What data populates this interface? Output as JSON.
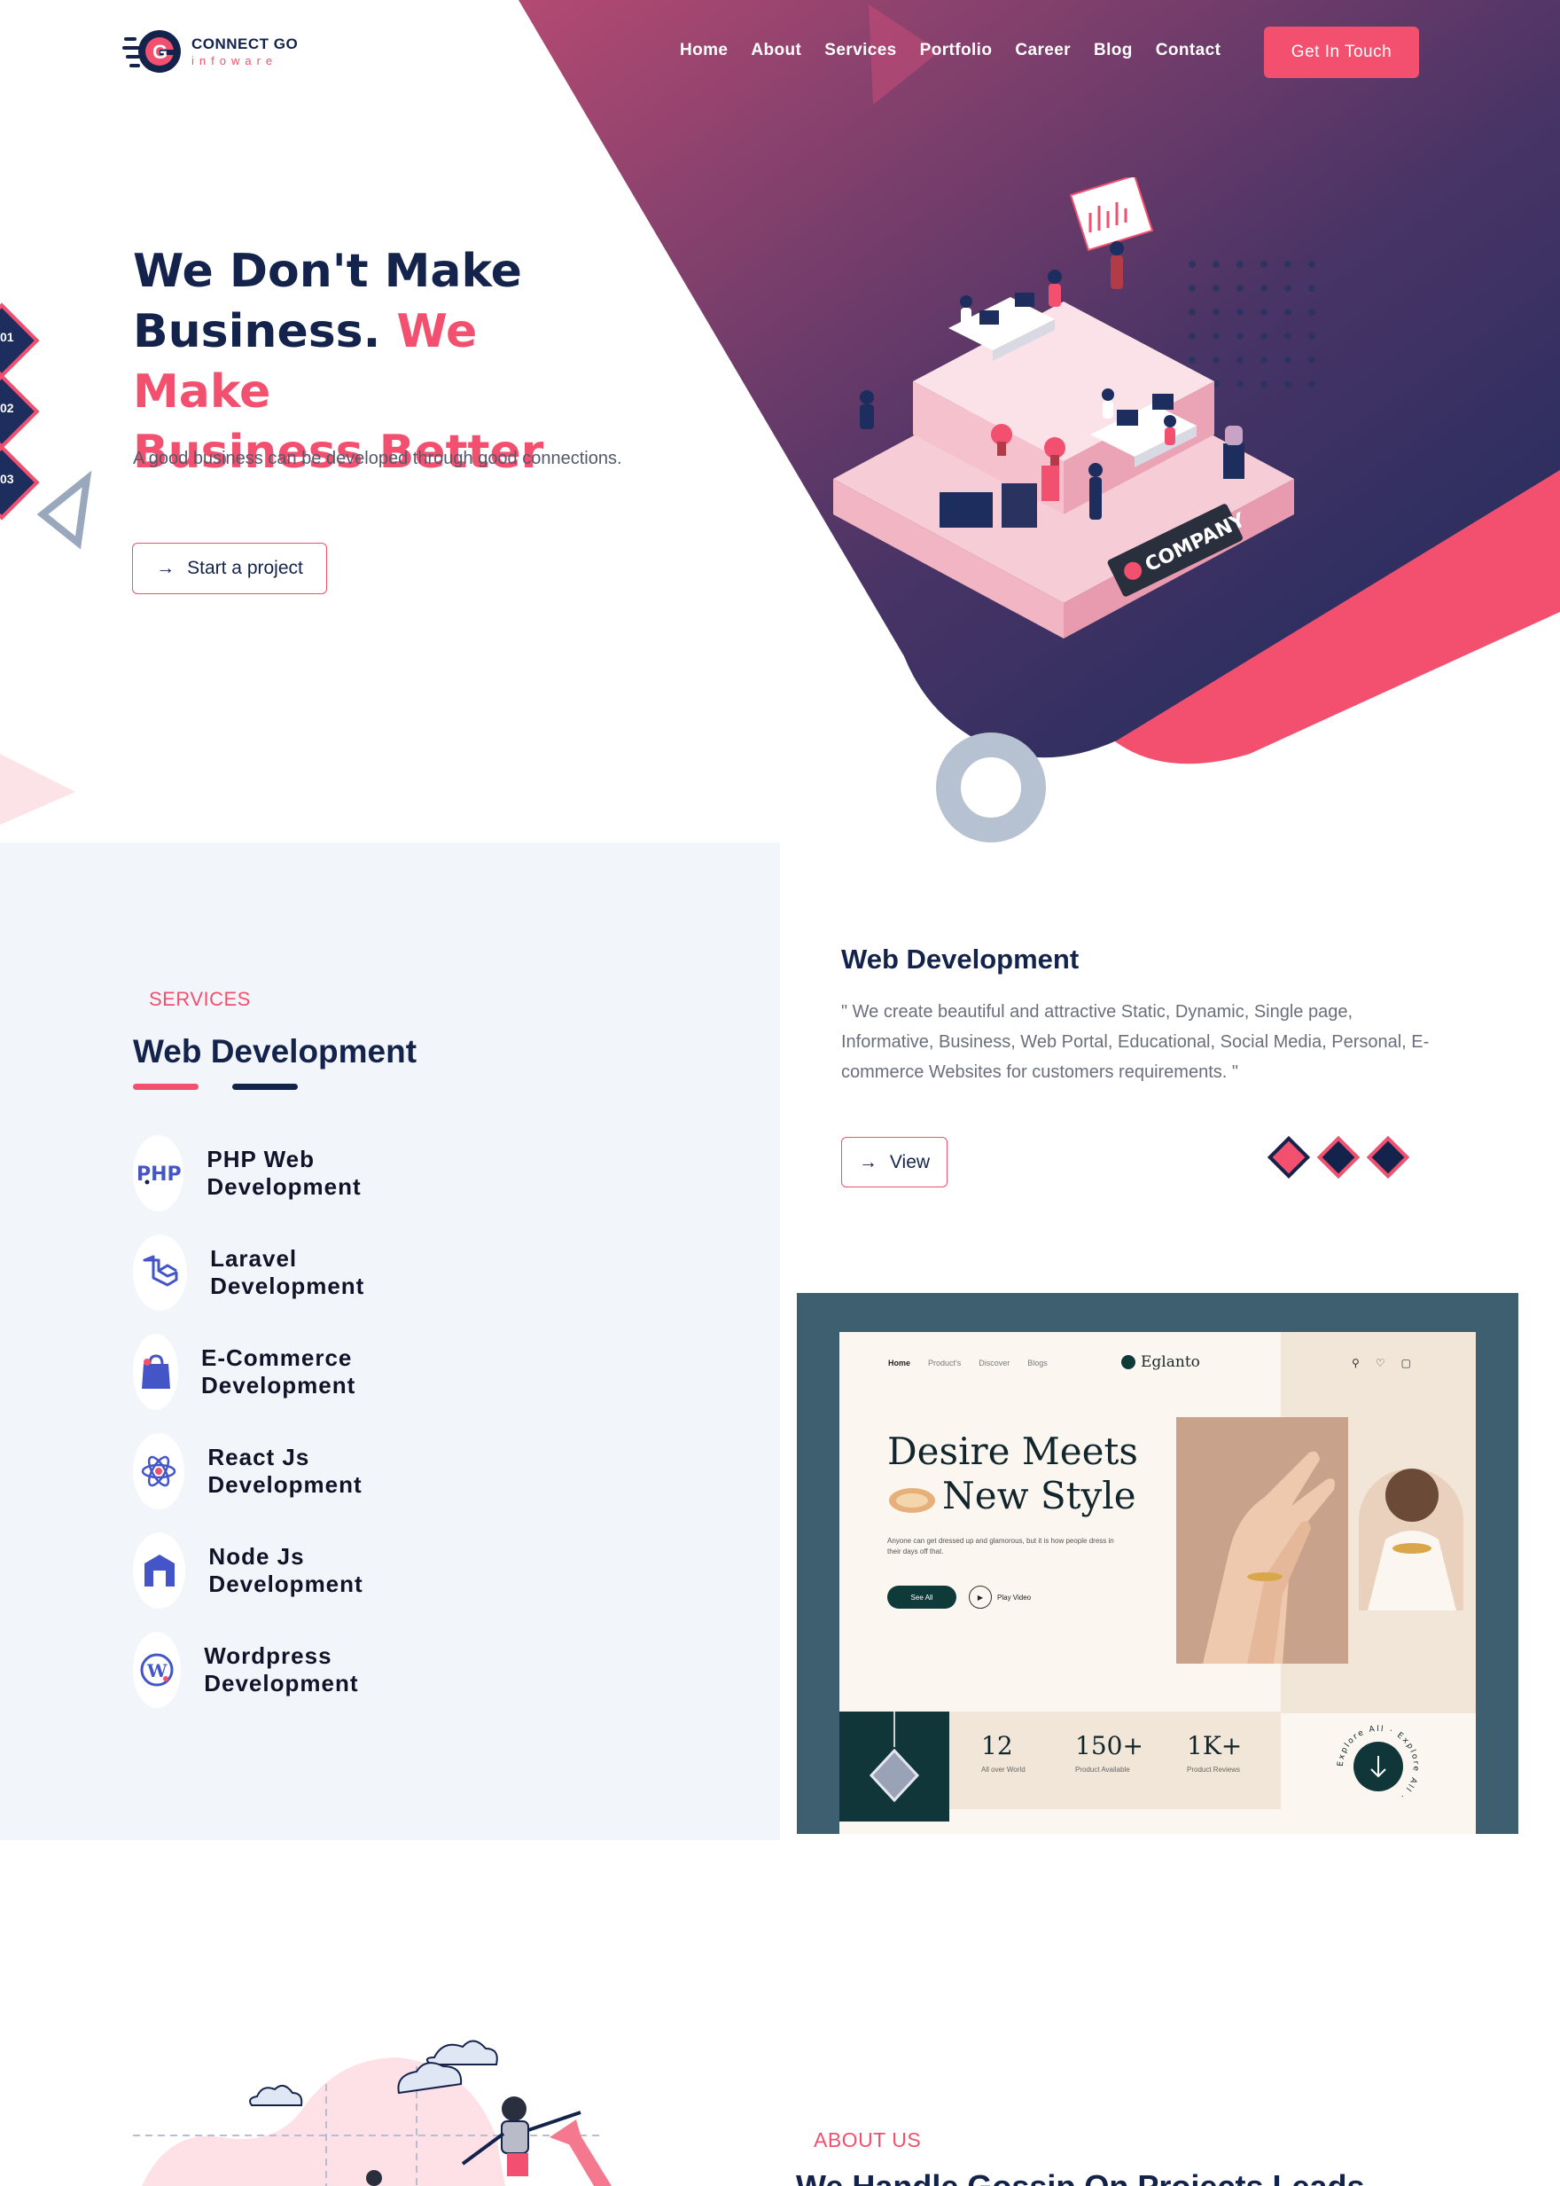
{
  "brand": {
    "name": "CONNECT GO",
    "sub": "infoware",
    "colors": {
      "primary": "#14234b",
      "accent": "#f2506e",
      "gradient_top": "#b34a72",
      "gradient_bottom": "#1a2b5c"
    }
  },
  "nav": {
    "links": [
      "Home",
      "About",
      "Services",
      "Portfolio",
      "Career",
      "Blog",
      "Contact"
    ],
    "cta": "Get In Touch"
  },
  "hero": {
    "title_line1": "We Don't Make",
    "title_line2_a": "Business.",
    "title_line2_b": "We Make",
    "title_line3": "Business Better",
    "subtitle": "A good business can be developed through good connections.",
    "button": "Start a project",
    "button_icon": "arrow-right-icon",
    "side_tabs": [
      "01",
      "02",
      "03"
    ],
    "illustration_label": "COMPANY"
  },
  "services": {
    "eyebrow": "SERVICES",
    "heading": "Web Development",
    "items": [
      {
        "label": "PHP Web Development",
        "icon": "php-icon"
      },
      {
        "label": "Laravel Development",
        "icon": "laravel-icon"
      },
      {
        "label": "E-Commerce Development",
        "icon": "shopping-bag-icon"
      },
      {
        "label": "React Js Development",
        "icon": "react-icon"
      },
      {
        "label": "Node Js Development",
        "icon": "node-icon"
      },
      {
        "label": "Wordpress Development",
        "icon": "wordpress-icon"
      }
    ],
    "detail": {
      "title": "Web Development",
      "text": "\" We create beautiful and attractive Static, Dynamic, Single page, Informative, Business, Web Portal, Educational, Social Media, Personal, E-commerce Websites for customers requirements. \"",
      "button": "View"
    }
  },
  "portfolio_mock": {
    "nav": [
      "Home",
      "Product's",
      "Discover",
      "Blogs"
    ],
    "brand": "Eglanto",
    "hero_line1": "Desire Meets",
    "hero_line2": "New Style",
    "copy": "Anyone can get dressed up and glamorous, but it is how people dress in their days off that.",
    "see_all": "See All",
    "play": "Play Video",
    "stats": [
      {
        "value": "12",
        "label": "All over World"
      },
      {
        "value": "150+",
        "label": "Product Available"
      },
      {
        "value": "1K+",
        "label": "Product Reviews"
      }
    ],
    "badge_text": "Explore All · Explore All ·"
  },
  "about": {
    "eyebrow": "ABOUT US",
    "heading": "We Handle Gossip On Projects Leads"
  }
}
